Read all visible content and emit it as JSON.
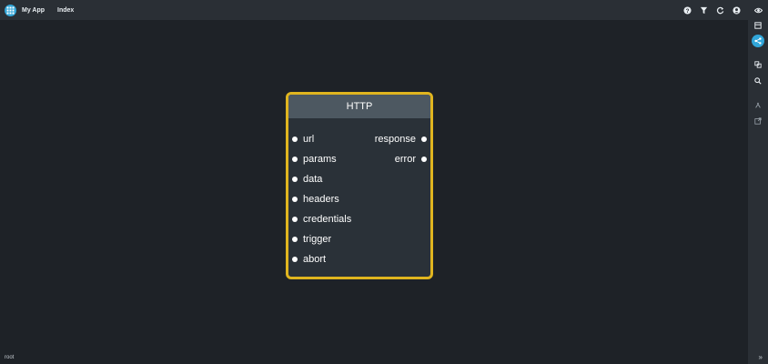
{
  "topbar": {
    "app_title": "My App",
    "index_label": "Index"
  },
  "node": {
    "title": "HTTP",
    "inputs": [
      "url",
      "params",
      "data",
      "headers",
      "credentials",
      "trigger",
      "abort"
    ],
    "outputs": [
      "response",
      "error"
    ]
  },
  "footer": {
    "path": "root",
    "expand_glyph": "»"
  },
  "colors": {
    "accent": "#31a6d9",
    "node_border": "#e0b51f",
    "background": "#1e2227"
  }
}
